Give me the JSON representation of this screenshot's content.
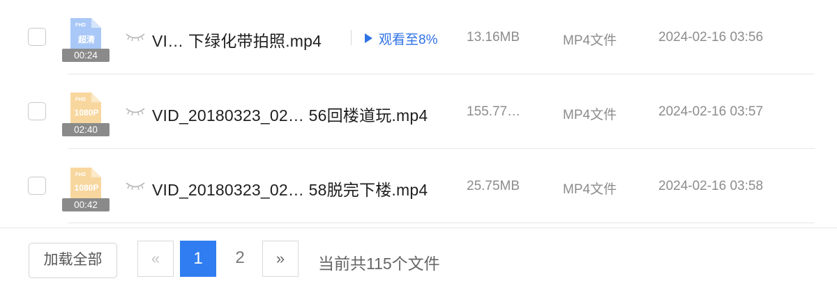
{
  "files": [
    {
      "name": "VI… 下绿化带拍照.mp4",
      "quality": "超清",
      "fhd": "FHD",
      "duration": "00:24",
      "watch_progress": "观看至8%",
      "size": "13.16MB",
      "type": "MP4文件",
      "date": "2024-02-16 03:56",
      "icon_color": "#a9c8f7"
    },
    {
      "name": "VID_20180323_02… 56回楼道玩.mp4",
      "quality": "1080P",
      "fhd": "FHD",
      "duration": "02:40",
      "watch_progress": "",
      "size": "155.77…",
      "type": "MP4文件",
      "date": "2024-02-16 03:57",
      "icon_color": "#f8d79f"
    },
    {
      "name": "VID_20180323_02… 58脱完下楼.mp4",
      "quality": "1080P",
      "fhd": "FHD",
      "duration": "00:42",
      "watch_progress": "",
      "size": "25.75MB",
      "type": "MP4文件",
      "date": "2024-02-16 03:58",
      "icon_color": "#f8d79f"
    }
  ],
  "footer": {
    "load_all": "加载全部",
    "prev": "«",
    "pages": [
      "1",
      "2"
    ],
    "next": "»",
    "total_text": "当前共115个文件"
  },
  "colors": {
    "accent": "#2f7df0",
    "link": "#2f72e5"
  }
}
